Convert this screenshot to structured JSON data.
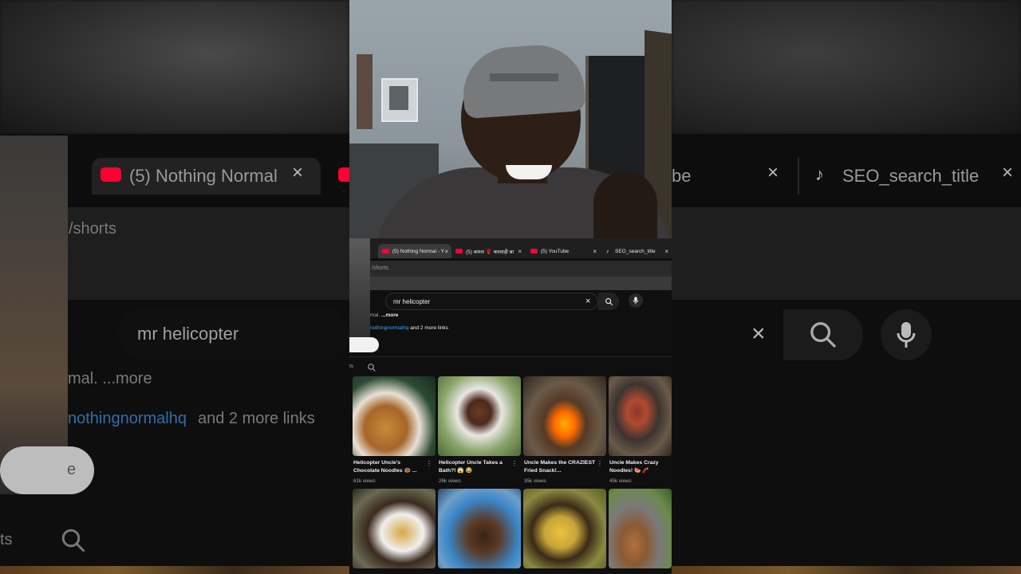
{
  "background": {
    "left": {
      "tab_title": "(5) Nothing Normal - Y",
      "url_fragment": "/shorts",
      "search_text": "mr helicopter",
      "desc_fragment": "mal. ...more",
      "links_handle": "nothingnormalhq",
      "links_suffix": " and 2 more links",
      "pill_fragment": "e",
      "shorts_fragment": "ts"
    },
    "right": {
      "tab_fragment": "be",
      "tab_title": "SEO_search_title"
    }
  },
  "browser": {
    "tabs": [
      {
        "label": "(5) Nothing Normal - Y",
        "icon": "youtube-icon",
        "active": true
      },
      {
        "label": "(5) कमल 🌹 करवाड़ी बा",
        "icon": "youtube-icon",
        "active": false
      },
      {
        "label": "(5) YouTube",
        "icon": "youtube-icon",
        "active": false
      },
      {
        "label": "SEO_search_title",
        "icon": "tiktok-icon",
        "active": false
      }
    ],
    "close_glyph": "×",
    "url_fragment": "/shorts",
    "search": {
      "value": "mr helicopter"
    },
    "channel": {
      "desc_prefix": "mal. ",
      "more": "...more",
      "handle": "nothingnormalhq",
      "links_suffix": " and 2 more links"
    },
    "shorts_label": "ts",
    "shorts": [
      {
        "title": "Helicopter Uncle's Chocolate Noodles 🍩 ...",
        "views": "61k views"
      },
      {
        "title": "Helicopter Uncle Takes a Bath?! 😱 😂",
        "views": "26k views"
      },
      {
        "title": "Uncle Makes the CRAZIEST Fried Snack!...",
        "views": "35k views"
      },
      {
        "title": "Uncle Makes Crazy Noodles! 🍉 🧨",
        "views": "45k views"
      },
      {
        "title": "",
        "views": ""
      },
      {
        "title": "",
        "views": ""
      },
      {
        "title": "",
        "views": ""
      },
      {
        "title": "",
        "views": ""
      }
    ]
  },
  "colors": {
    "youtube_red": "#ff0033",
    "link_blue": "#3ea6ff",
    "page_bg": "#0f0f0f"
  }
}
